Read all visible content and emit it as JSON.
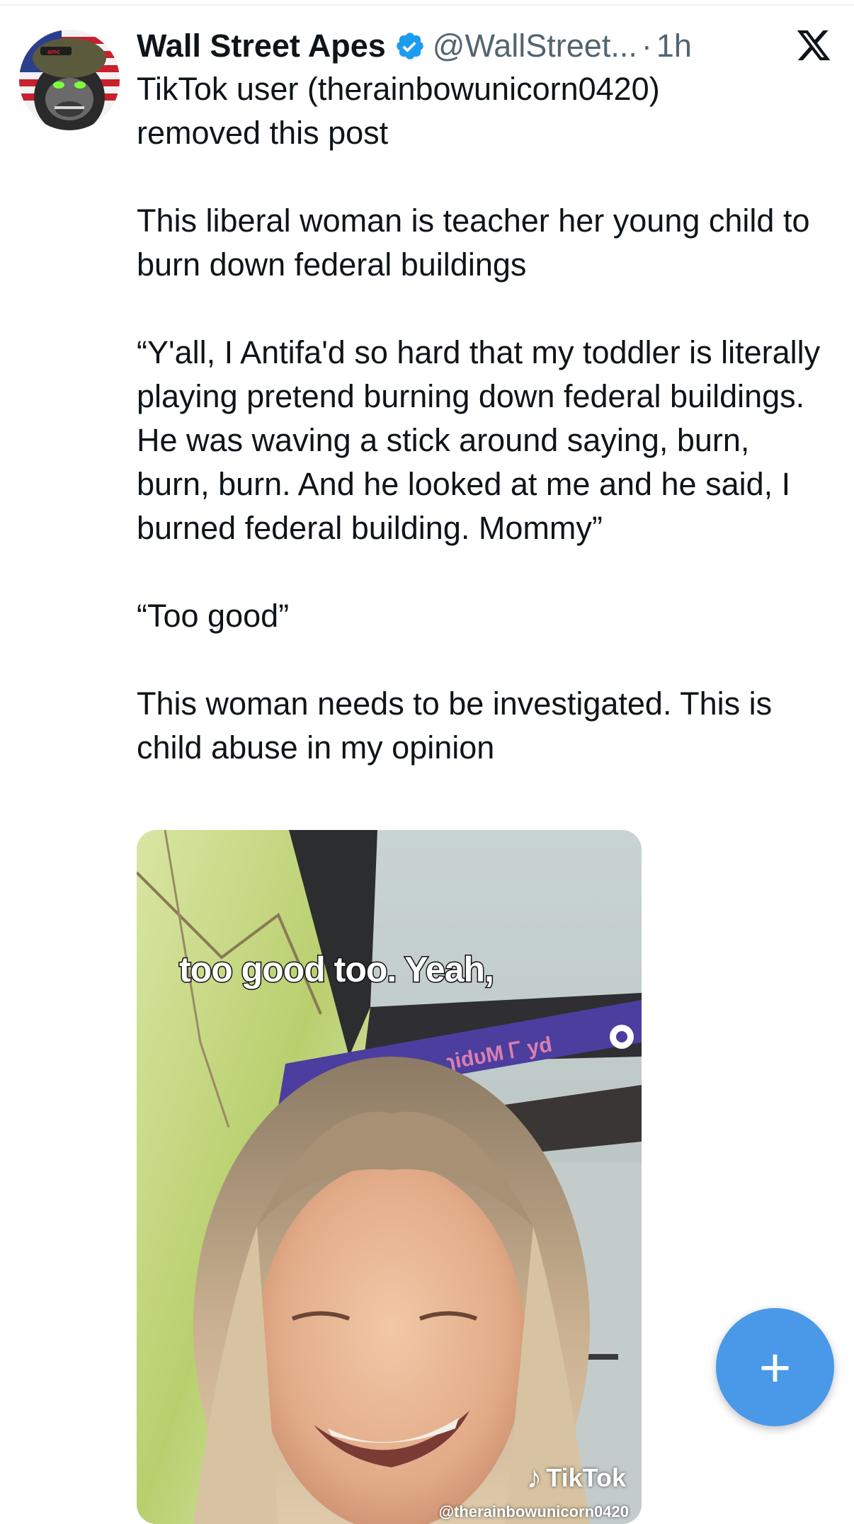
{
  "tweet": {
    "author": {
      "name": "Wall Street Apes",
      "handle": "@WallStreet...",
      "separator": "·",
      "time": "1h",
      "verified": true,
      "avatar_icon": "ape-soldier-avatar"
    },
    "text": {
      "p1_line1": "TikTok user (therainbowunicorn0420)",
      "p1_line2": "removed this post",
      "p2": "This liberal woman is teacher her young child to burn down federal buildings",
      "p3": "“Y'all, I Antifa'd so hard that my toddler is literally playing pretend burning down federal buildings. He was waving a stick around saying, burn, burn, burn. And he looked at me and he said, I burned federal building. Mommy”",
      "p4": "“Too good”",
      "p5": "This woman needs to be investigated. This is child abuse in my opinion"
    },
    "media": {
      "caption": "too good too. Yeah,",
      "watermark_brand": "TikTok",
      "watermark_user": "@therainbowunicorn0420",
      "sign_text": "ɿidυM Ꮁ yd"
    }
  },
  "compose_button": {
    "label": "+",
    "icon": "plus-icon"
  },
  "colors": {
    "verified_badge": "#1d9bf0",
    "compose_fab": "#4a99e9",
    "secondary_text": "#536471"
  }
}
